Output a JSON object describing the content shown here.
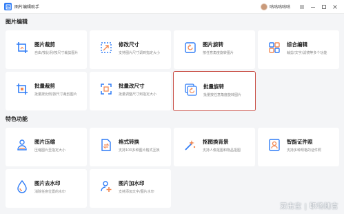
{
  "app": {
    "title": "图片编辑助手",
    "username": "咕咕咕咕咕"
  },
  "sections": {
    "editing": "图片编辑",
    "features": "特色功能"
  },
  "cards": [
    {
      "title": "图片裁剪",
      "desc": "自由/按比例/按尺寸裁剪图片"
    },
    {
      "title": "修改尺寸",
      "desc": "支持图片尺寸调到指定大小"
    },
    {
      "title": "图片旋转",
      "desc": "按任意角度旋转图片"
    },
    {
      "title": "综合编辑",
      "desc": "裁剪/文字/滤镜等多个功能"
    },
    {
      "title": "批量裁剪",
      "desc": "批量按比例/按尺寸裁剪图片"
    },
    {
      "title": "批量改尺寸",
      "desc": "批量调整尺寸到指定大小"
    },
    {
      "title": "批量旋转",
      "desc": "批量按任意角度旋转图片"
    },
    {
      "title": "图片压缩",
      "desc": "压缩图片至指定大小"
    },
    {
      "title": "格式转换",
      "desc": "支持100多种图片格式互换"
    },
    {
      "title": "抠图换背景",
      "desc": "支持人像抠图和物品抠图"
    },
    {
      "title": "智能证件照",
      "desc": "支持多种规格的证件照"
    },
    {
      "title": "图片去水印",
      "desc": "消除任意位置的水印"
    },
    {
      "title": "图片加水印",
      "desc": "支持添加文字/图片水印"
    }
  ],
  "watermark": "双击宝 | 职场随言",
  "colors": {
    "accent": "#2f7cf6",
    "highlight_border": "#c94f46",
    "icon_orange": "#f28a55"
  },
  "icons": [
    "crop-icon",
    "resize-icon",
    "rotate-icon",
    "edit-grid-icon",
    "batch-crop-icon",
    "batch-resize-icon",
    "batch-rotate-icon",
    "compress-icon",
    "convert-icon",
    "cutout-icon",
    "id-photo-icon",
    "remove-watermark-icon",
    "add-watermark-icon"
  ]
}
